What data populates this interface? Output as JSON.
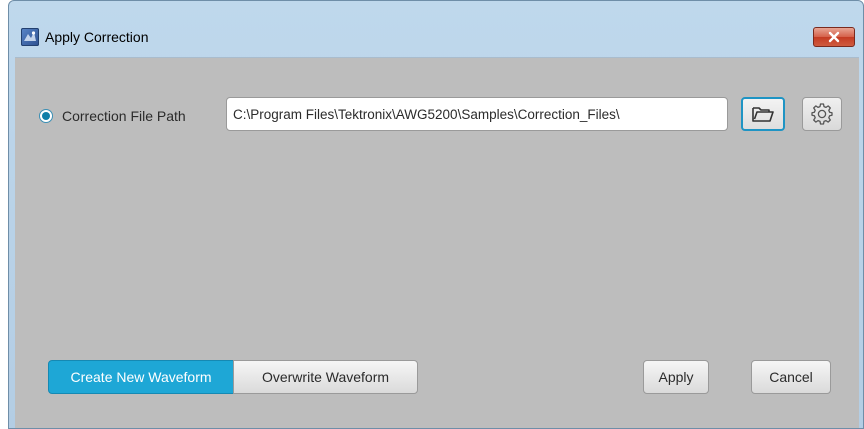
{
  "window": {
    "title": "Apply Correction",
    "close_label": ""
  },
  "correction": {
    "radio_label": "Correction File Path",
    "radio_selected": true,
    "path_value": "C:\\Program Files\\Tektronix\\AWG5200\\Samples\\Correction_Files\\"
  },
  "mode": {
    "create_label": "Create New Waveform",
    "overwrite_label": "Overwrite Waveform",
    "selected": "Create New Waveform"
  },
  "actions": {
    "apply_label": "Apply",
    "cancel_label": "Cancel"
  },
  "icons": {
    "app": "app-icon",
    "close": "close-icon",
    "browse": "folder-open-icon",
    "settings": "gear-icon"
  },
  "colors": {
    "accent": "#1ea7d6",
    "client_bg": "#bdbdbd",
    "close_red": "#c43b23",
    "title_bar": "#bfd8ec"
  }
}
